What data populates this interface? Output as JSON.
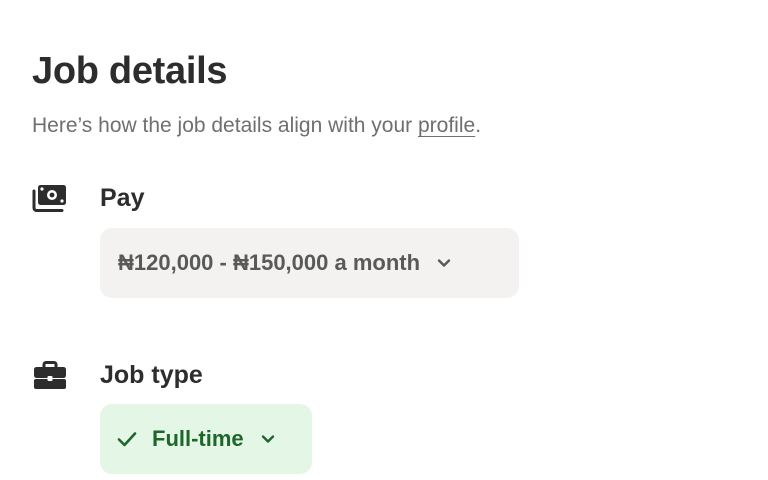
{
  "header": {
    "title": "Job details",
    "subtitle_prefix": "Here’s how the job details align with your ",
    "subtitle_link": "profile",
    "subtitle_suffix": "."
  },
  "sections": {
    "pay": {
      "icon": "money-icon",
      "label": "Pay",
      "value": "₦120,000 - ₦150,000 a month"
    },
    "job_type": {
      "icon": "briefcase-icon",
      "label": "Job type",
      "value": "Full-time",
      "matched": true
    }
  },
  "colors": {
    "pay_chip_bg": "#f3f2f1",
    "match_chip_bg": "#e4f7e6",
    "match_text": "#1f662c"
  }
}
